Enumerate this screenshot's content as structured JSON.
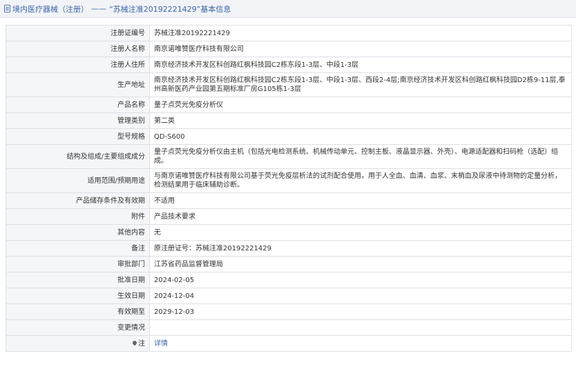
{
  "header": {
    "breadcrumb_root": "境内医疗器械（注册）",
    "separator": "——",
    "record_title": "“苏械注准20192221429”基本信息"
  },
  "rows": [
    {
      "label": "注册证编号",
      "value": "苏械注准20192221429"
    },
    {
      "label": "注册人名称",
      "value": "南京诺唯赞医疗科技有限公司"
    },
    {
      "label": "注册人住所",
      "value": "南京经济技术开发区科创路红枫科技园C2栋东段1-3层、中段1-3层"
    },
    {
      "label": "生产地址",
      "value": "南京经济技术开发区科创路红枫科技园C2栋东段1-3层、中段1-3层、西段2-4层;南京经济技术开发区科创路红枫科技园D2栋9-11层,泰州高新医药产业园第五期标准厂房G105栋1-3层"
    },
    {
      "label": "产品名称",
      "value": "量子点荧光免疫分析仪"
    },
    {
      "label": "管理类别",
      "value": "第二类"
    },
    {
      "label": "型号规格",
      "value": "QD-S600"
    },
    {
      "label": "结构及组成/主要组成成分",
      "value": "量子点荧光免疫分析仪由主机（包括光电检测系统、机械传动单元、控制主板、液晶显示器、外壳）、电源适配器和扫码枪（选配）组成。"
    },
    {
      "label": "适用范围/预期用途",
      "value": "与南京诺唯赞医疗科技有限公司基于荧光免疫层析法的试剂配合使用，用于人全血、血清、血浆、末梢血及尿液中待测物的定量分析，检测结果用于临床辅助诊断。"
    },
    {
      "label": "产品储存条件及有效期",
      "value": "不适用"
    },
    {
      "label": "附件",
      "value": "产品技术要求"
    },
    {
      "label": "其他内容",
      "value": "无"
    },
    {
      "label": "备注",
      "value": "原注册证号：苏械注准20192221429"
    },
    {
      "label": "审批部门",
      "value": "江苏省药品监督管理局"
    },
    {
      "label": "批准日期",
      "value": "2024-02-05"
    },
    {
      "label": "生效日期",
      "value": "2024-12-04"
    },
    {
      "label": "有效期至",
      "value": "2029-12-03"
    },
    {
      "label": "变更情况",
      "value": ""
    },
    {
      "label": "注",
      "value": "详情"
    }
  ],
  "colors": {
    "link": "#3a66a8",
    "label_bg": "#f5f6f8",
    "border": "#dcdfe6"
  },
  "icons": {
    "header": "document-icon",
    "note_label": "pin-icon"
  }
}
